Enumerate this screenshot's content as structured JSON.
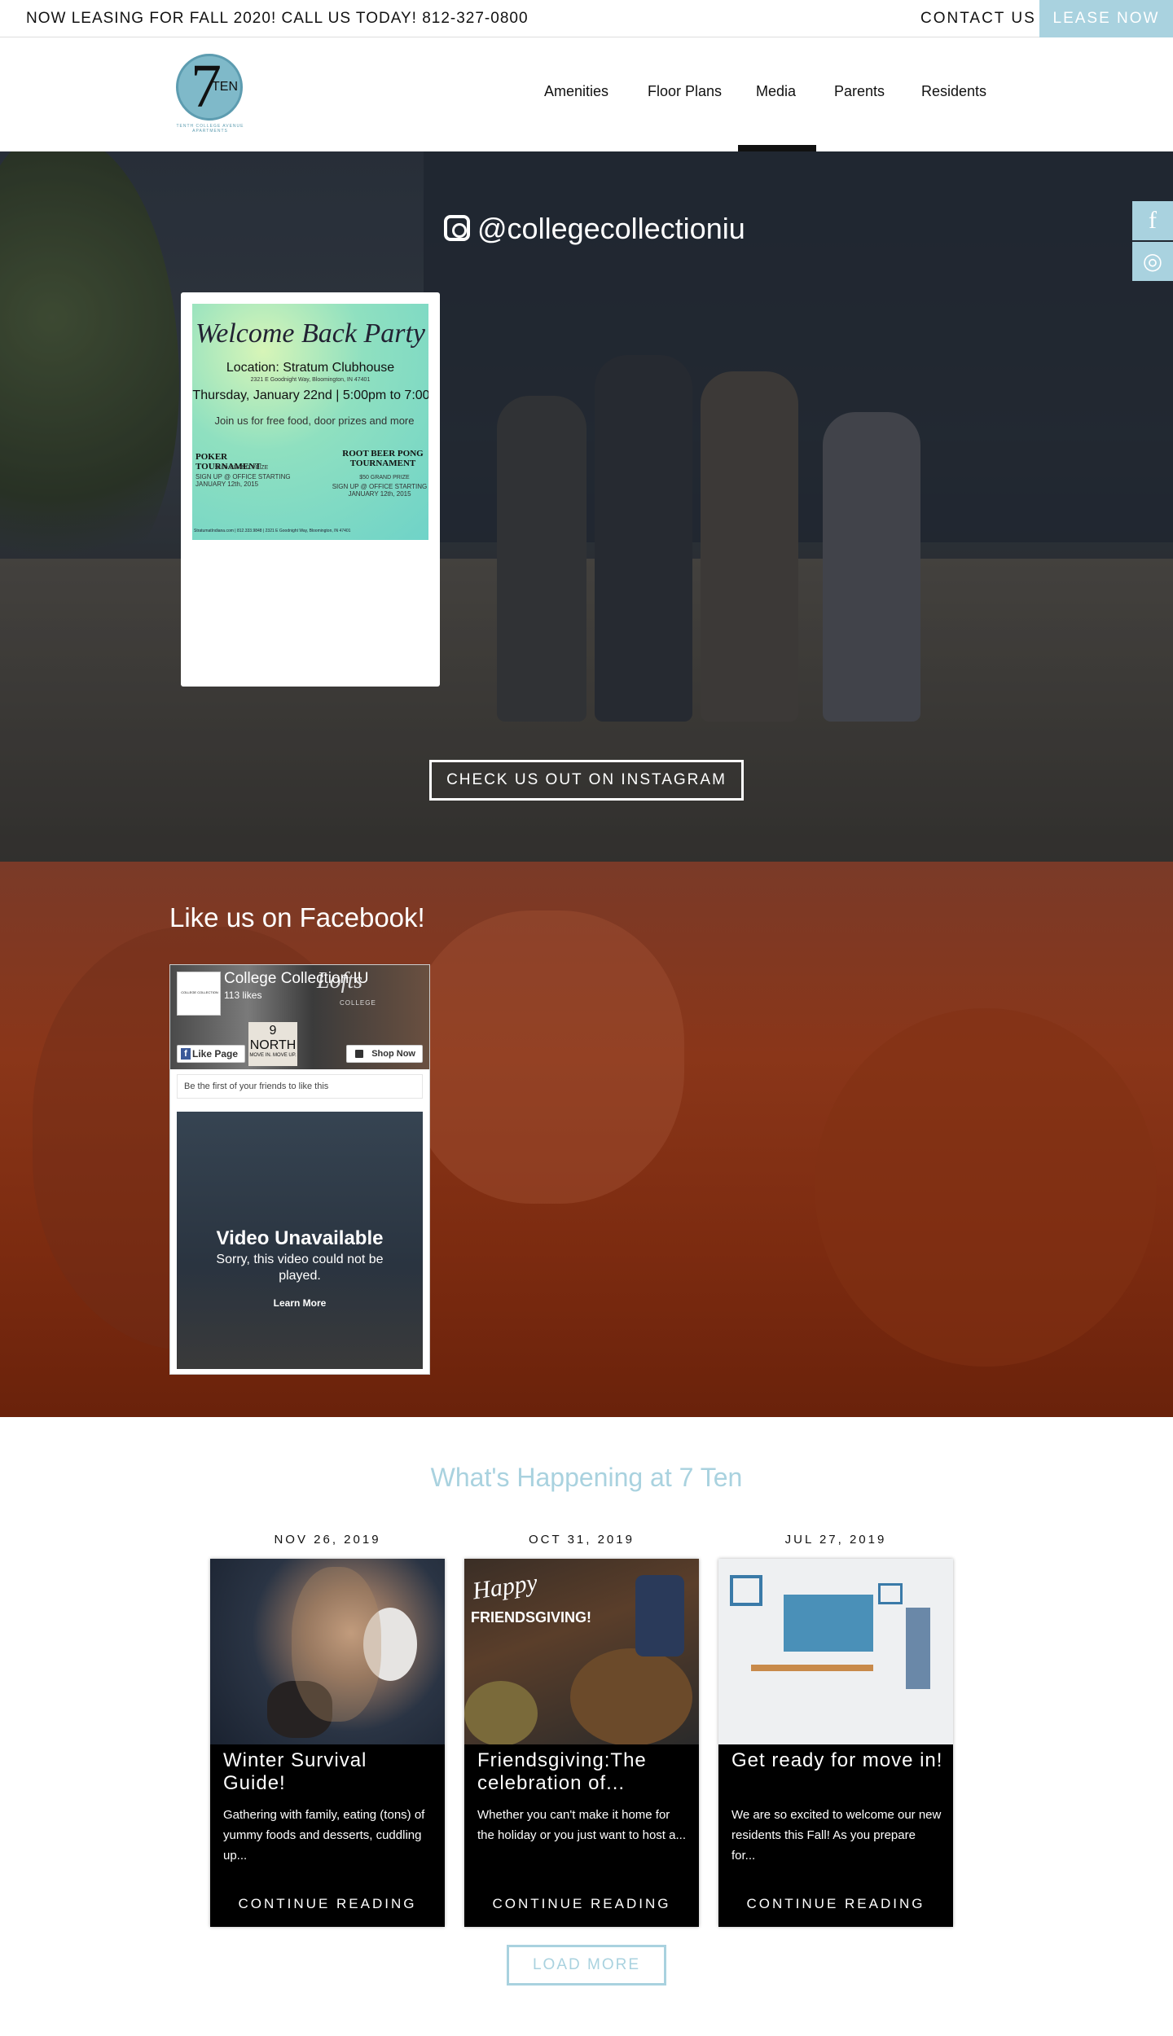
{
  "topbar": {
    "announcement": "NOW LEASING FOR FALL 2020! CALL US TODAY! 812-327-0800",
    "contact_label": "CONTACT US",
    "lease_label": "LEASE NOW"
  },
  "logo": {
    "seven": "7",
    "ten": "TEN",
    "sub": "TENTH COLLEGE AVENUE APARTMENTS"
  },
  "nav": {
    "items": [
      "Amenities",
      "Floor Plans",
      "Media",
      "Parents",
      "Residents"
    ],
    "active": "Media"
  },
  "instagram": {
    "handle": "@collegecollectioniu",
    "button_label": "CHECK US OUT ON INSTAGRAM",
    "post": {
      "title": "Welcome Back Party",
      "location": "Location: Stratum Clubhouse",
      "address": "2321 E Goodnight Way, Bloomington, IN 47401",
      "date_line": "Thursday, January 22nd | 5:00pm to 7:00",
      "tagline": "Join us for free food, door prizes and more",
      "left_event": "POKER TOURNAMENT",
      "left_prize": "$100 GRAND PRIZE",
      "left_signup": "SIGN UP @ OFFICE STARTING JANUARY 12th, 2015",
      "right_event": "ROOT BEER PONG TOURNAMENT",
      "right_prize": "$50 GRAND PRIZE",
      "right_signup": "SIGN UP @ OFFICE STARTING JANUARY 12th, 2015",
      "footer": "StratumatIndiana.com | 812.333.9848 | 2321 E Goodnight Way, Bloomington, IN 47401"
    }
  },
  "social_side": {
    "facebook_icon": "facebook-icon",
    "instagram_icon": "instagram-icon",
    "facebook_glyph": "f",
    "instagram_glyph": "◎"
  },
  "facebook": {
    "heading": "Like us on Facebook!",
    "page_name": "College Collection IU",
    "likes": "113 likes",
    "thumb_text": "COLLEGE COLLECTION",
    "lofts": "Lofts",
    "lofts_sub": "COLLEGE",
    "north_num": "9",
    "north_name": "NORTH",
    "north_tag": "MOVE IN. MOVE UP.",
    "like_button": "Like Page",
    "shop_button": "Shop Now",
    "first_friends": "Be the first of your friends to like this",
    "video_title": "Video Unavailable",
    "video_sub": "Sorry, this video could not be played.",
    "video_link": "Learn More"
  },
  "blog": {
    "heading": "What's Happening at 7 Ten",
    "posts": [
      {
        "date": "NOV 26, 2019",
        "title": "Winter Survival Guide!",
        "excerpt": "Gathering with family, eating (tons) of yummy foods and desserts, cuddling up...",
        "cta": "CONTINUE READING"
      },
      {
        "date": "OCT 31, 2019",
        "title": "Friendsgiving:The celebration of...",
        "excerpt": "Whether you can't make it home for the holiday or you just want to host a...",
        "cta": "CONTINUE READING",
        "image_text_1": "Happy",
        "image_text_2": "FRIENDSGIVING!"
      },
      {
        "date": "JUL 27, 2019",
        "title": "Get ready for move in!",
        "excerpt": "We are so excited to welcome our new residents this Fall! As you prepare for...",
        "cta": "CONTINUE READING"
      }
    ],
    "load_more": "LOAD MORE"
  },
  "colors": {
    "accent": "#a9d2df",
    "facebook_overlay": "#8a3619",
    "instagram_overlay": "#2e3642"
  }
}
